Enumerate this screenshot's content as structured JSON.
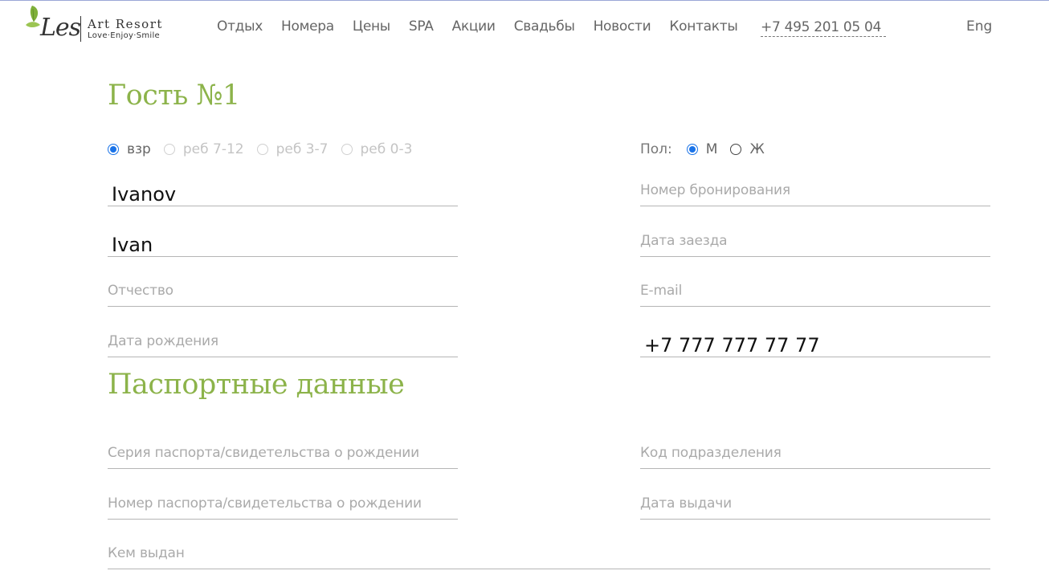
{
  "header": {
    "logo": {
      "name": "Les",
      "title": "Art Resort",
      "tagline": "Love·Enjoy·Smile"
    },
    "nav": [
      "Отдых",
      "Номера",
      "Цены",
      "SPA",
      "Акции",
      "Свадьбы",
      "Новости",
      "Контакты"
    ],
    "phone": "+7 495 201 05 04",
    "lang": "Eng"
  },
  "guest": {
    "title": "Гость №1",
    "age_options": [
      {
        "label": "взр",
        "checked": true
      },
      {
        "label": "реб 7-12",
        "checked": false
      },
      {
        "label": "реб 3-7",
        "checked": false
      },
      {
        "label": "реб 0-3",
        "checked": false
      }
    ],
    "gender": {
      "label": "Пол:",
      "options": [
        {
          "label": "М",
          "checked": true
        },
        {
          "label": "Ж",
          "checked": false
        }
      ]
    },
    "fields": {
      "last_name": {
        "value": "Ivanov",
        "placeholder": ""
      },
      "first_name": {
        "value": "Ivan",
        "placeholder": ""
      },
      "patronymic": {
        "value": "",
        "placeholder": "Отчество"
      },
      "birth_date": {
        "value": "",
        "placeholder": "Дата рождения"
      },
      "booking_number": {
        "value": "",
        "placeholder": "Номер бронирования"
      },
      "arrival_date": {
        "value": "",
        "placeholder": "Дата заезда"
      },
      "email": {
        "value": "",
        "placeholder": "E-mail"
      },
      "phone": {
        "value": "+7 777 777 77 77",
        "placeholder": ""
      }
    }
  },
  "passport": {
    "title": "Паспортные данные",
    "fields": {
      "series": {
        "placeholder": "Серия паспорта/свидетельства о рождении"
      },
      "number": {
        "placeholder": "Номер паспорта/свидетельства о рождении"
      },
      "issued_by": {
        "placeholder": "Кем выдан"
      },
      "division_code": {
        "placeholder": "Код подразделения"
      },
      "issue_date": {
        "placeholder": "Дата выдачи"
      }
    }
  },
  "colors": {
    "accent_green": "#8cb34a",
    "radio_blue": "#1a73e8",
    "leaf_green": "#7fb03a"
  },
  "icons": [
    "leaf-icon"
  ]
}
